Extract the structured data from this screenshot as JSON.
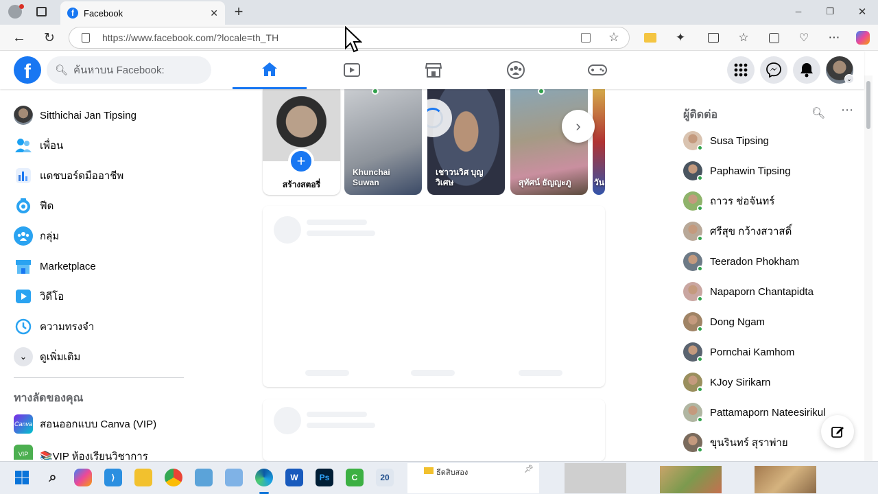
{
  "browser": {
    "tab_title": "Facebook",
    "tab_close": "✕",
    "new_tab": "+",
    "url": "https://www.facebook.com/?locale=th_TH",
    "window_controls": [
      "─",
      "❐",
      "✕"
    ]
  },
  "header": {
    "logo": "f",
    "search_placeholder": "ค้นหาบน Facebook:",
    "nav_icons": [
      "home-icon",
      "video-icon",
      "marketplace-icon",
      "groups-icon",
      "gaming-icon"
    ],
    "right_icons": [
      "menu-grid-icon",
      "messenger-icon",
      "notifications-icon",
      "profile-avatar"
    ]
  },
  "left_sidebar": {
    "items": [
      {
        "label": "Sitthichai Jan Tipsing",
        "icon": "user-avatar"
      },
      {
        "label": "เพื่อน",
        "icon": "friends-icon"
      },
      {
        "label": "แดชบอร์ดมืออาชีพ",
        "icon": "dashboard-icon"
      },
      {
        "label": "ฟีด",
        "icon": "feed-icon"
      },
      {
        "label": "กลุ่ม",
        "icon": "groups-icon"
      },
      {
        "label": "Marketplace",
        "icon": "marketplace-icon"
      },
      {
        "label": "วิดีโอ",
        "icon": "video-icon"
      },
      {
        "label": "ความทรงจำ",
        "icon": "memories-icon"
      },
      {
        "label": "ดูเพิ่มเติม",
        "icon": "chevron-down-icon"
      }
    ],
    "shortcuts_heading": "ทางลัดของคุณ",
    "shortcuts": [
      {
        "label": "สอนออกแบบ Canva (VIP)",
        "icon": "Canva"
      },
      {
        "label": "📚VIP ห้องเรียนวิชาการ",
        "icon": "VIP"
      }
    ]
  },
  "stories": [
    {
      "label": "สร้างสตอรี่",
      "type": "create"
    },
    {
      "label": "Khunchai Suwan"
    },
    {
      "label": "เชาวนวิศ บุญวิเศษ"
    },
    {
      "label": "สุทัศน์ ธัญญะภู"
    },
    {
      "label": "วัน"
    }
  ],
  "contacts": {
    "heading": "ผู้ติดต่อ",
    "list": [
      "Susa Tipsing",
      "Paphawin Tipsing",
      "ถาวร ช่อจันทร์",
      "ศรีสุข กว้างสวาสดิ์",
      "Teeradon Phokham",
      "Napaporn Chantapidta",
      "Dong Ngam",
      "Pornchai Kamhom",
      "KJoy Sirikarn",
      "Pattamaporn Nateesirikul",
      "ขุนรินทร์ สุราพ่าย"
    ]
  },
  "taskbar": {
    "folder_label": "ธีดสิบสอง",
    "word_badge": "20"
  },
  "colors": {
    "brand": "#1877f2",
    "online": "#31a24c"
  }
}
